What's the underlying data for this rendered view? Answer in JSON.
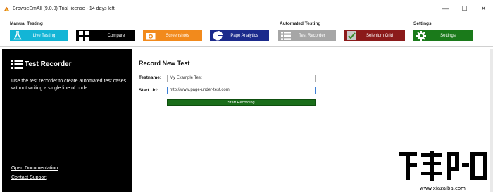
{
  "window": {
    "title": "BrowseEmAll (9.0.0) Trial license - 14 days left",
    "controls": {
      "minimize": "—",
      "maximize": "☐",
      "close": "✕"
    }
  },
  "ribbon": {
    "groups": {
      "manual": "Manual Testing",
      "automated": "Automated Testing",
      "settings": "Settings"
    },
    "buttons": {
      "live_testing": {
        "label": "Live Testing",
        "icon": "flask-icon",
        "color": "#13b5d6"
      },
      "compare": {
        "label": "Compare",
        "icon": "grid-icon",
        "color": "#000000"
      },
      "screenshots": {
        "label": "Screenshots",
        "icon": "camera-icon",
        "color": "#f28a1c"
      },
      "page_analytics": {
        "label": "Page Analytics",
        "icon": "pie-chart-icon",
        "color": "#1b2a8c"
      },
      "test_recorder": {
        "label": "Test Recorder",
        "icon": "list-icon",
        "color": "#a6a6a6"
      },
      "selenium_grid": {
        "label": "Selenium Grid",
        "icon": "selenium-icon",
        "color": "#8b1a1a"
      },
      "settings": {
        "label": "Settings",
        "icon": "gear-icon",
        "color": "#1a7a1a"
      }
    }
  },
  "sidebar": {
    "title": "Test Recorder",
    "description": "Use the test recorder to create automated test cases without writing a single line of code.",
    "links": {
      "documentation": "Open Documentation",
      "support": "Contact Support"
    }
  },
  "main": {
    "title": "Record New Test",
    "testname_label": "Testname:",
    "testname_value": "My Example Test",
    "start_url_label": "Start Url:",
    "start_url_value": "http://www.page-under-test.com",
    "start_button": "Start Recording"
  },
  "watermark": {
    "url": "www.xiazaiba.com"
  }
}
